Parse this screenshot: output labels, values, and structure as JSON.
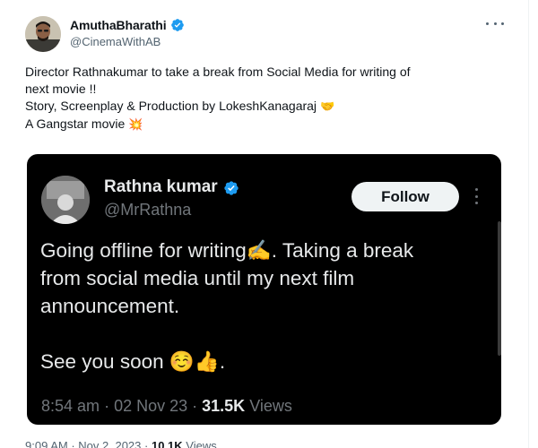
{
  "tweet": {
    "author": {
      "display_name": "AmuthaBharathi",
      "handle": "@CinemaWithAB"
    },
    "text_lines": [
      "Director Rathnakumar to take a break from Social Media for writing of",
      "next movie !!",
      "Story, Screenplay & Production by LokeshKanagaraj",
      "A Gangstar movie"
    ],
    "emoji": {
      "handshake": "🤝",
      "collision": "💥"
    },
    "footer": {
      "time": "9:09 AM",
      "date": "Nov 2, 2023",
      "views_count": "10.1K",
      "views_label": "Views"
    }
  },
  "embedded": {
    "author": {
      "display_name": "Rathna kumar",
      "handle": "@MrRathna"
    },
    "follow_label": "Follow",
    "text_lines": [
      "Going offline for writing✍️. Taking a break",
      "from social media until my next film",
      "announcement.",
      "See you soon ☺️👍."
    ],
    "time": "8:54 am",
    "date": "02 Nov 23",
    "views_count": "31.5K",
    "views_label": "Views"
  },
  "colors": {
    "verified_blue": "#1d9bf0",
    "secondary_text": "#536471",
    "card_background": "#000000"
  }
}
